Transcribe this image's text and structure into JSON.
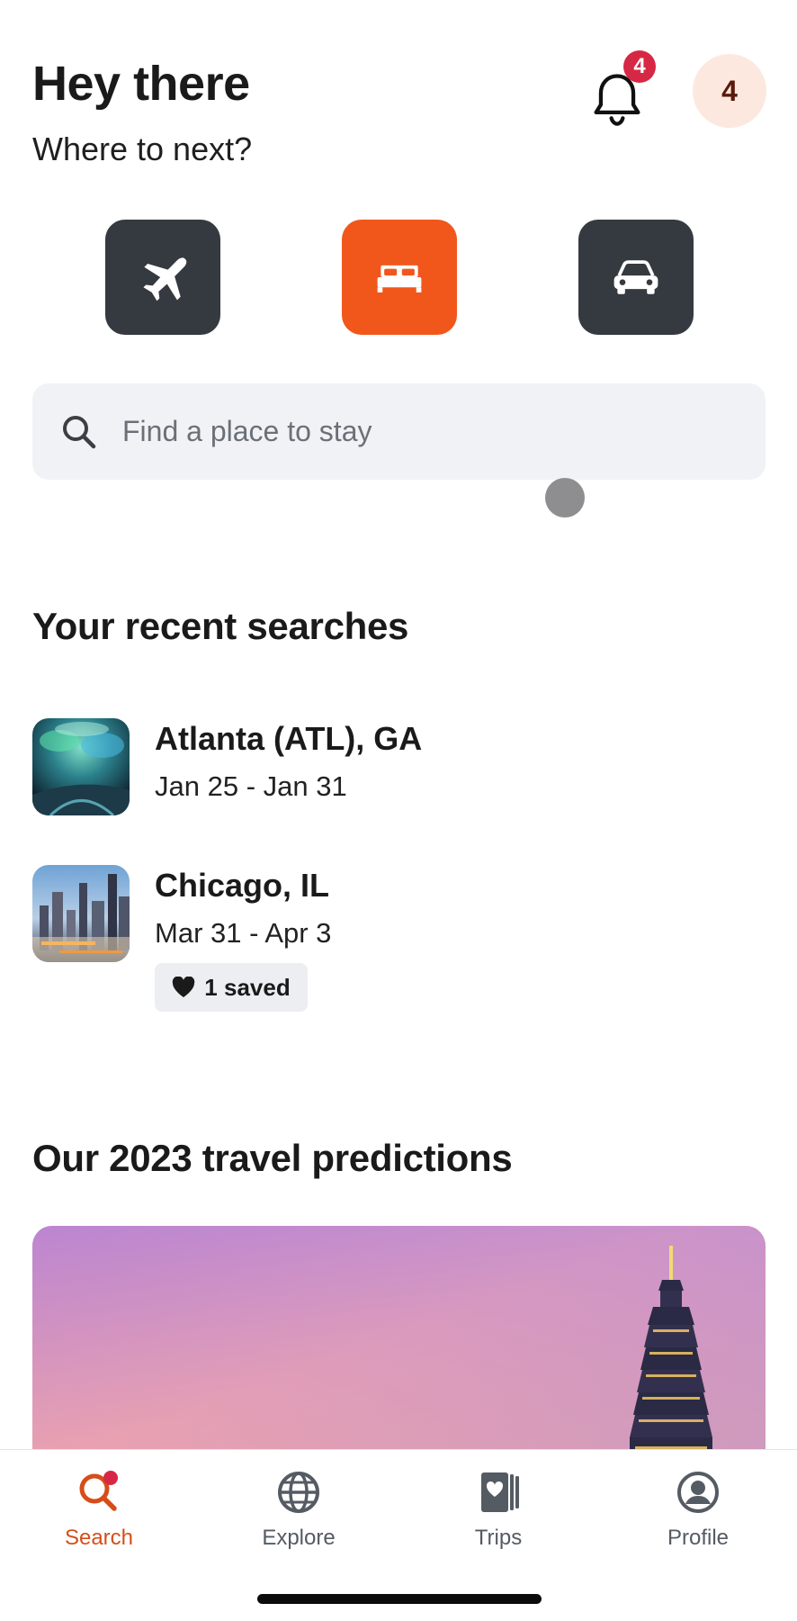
{
  "header": {
    "greeting": "Hey there",
    "subtitle": "Where to next?",
    "notification_count": "4",
    "avatar_initial": "4"
  },
  "categories": [
    {
      "name": "Flights",
      "icon": "airplane-icon",
      "active": false
    },
    {
      "name": "Stays",
      "icon": "bed-icon",
      "active": true
    },
    {
      "name": "Cars",
      "icon": "car-icon",
      "active": false
    }
  ],
  "search": {
    "placeholder": "Find a place to stay"
  },
  "recent_searches": {
    "heading": "Your recent searches",
    "items": [
      {
        "title": "Atlanta (ATL), GA",
        "dates": "Jan 25 - Jan 31"
      },
      {
        "title": "Chicago, IL",
        "dates": "Mar 31 - Apr 3",
        "saved_label": "1 saved"
      }
    ]
  },
  "predictions": {
    "heading": "Our 2023 travel predictions"
  },
  "nav": {
    "items": [
      {
        "label": "Search",
        "icon": "search-icon",
        "active": true
      },
      {
        "label": "Explore",
        "icon": "globe-icon",
        "active": false
      },
      {
        "label": "Trips",
        "icon": "trips-icon",
        "active": false
      },
      {
        "label": "Profile",
        "icon": "profile-icon",
        "active": false
      }
    ]
  },
  "colors": {
    "accent": "#f1571b",
    "tile_dark": "#353940",
    "badge": "#d62845",
    "nav_active": "#d54e1a"
  }
}
